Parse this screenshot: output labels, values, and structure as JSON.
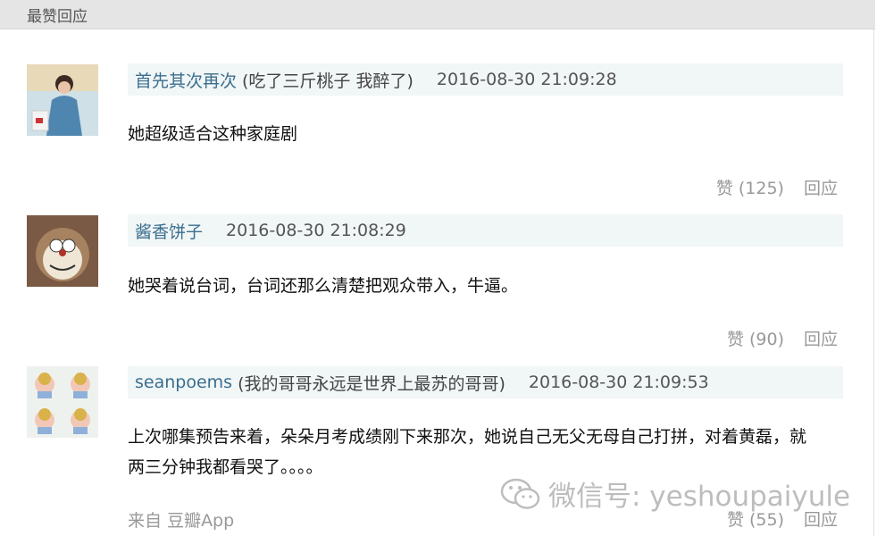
{
  "section": {
    "title": "最赞回应"
  },
  "comments": [
    {
      "author": "首先其次再次",
      "signature": "(吃了三斤桃子 我醉了)",
      "time": "2016-08-30 21:09:28",
      "lines": [
        "她超级适合这种家庭剧"
      ],
      "like_label": "赞 (125)",
      "reply_label": "回应"
    },
    {
      "author": "酱香饼子",
      "signature": "",
      "time": "2016-08-30 21:08:29",
      "lines": [
        "她哭着说台词，台词还那么清楚把观众带入，牛逼。"
      ],
      "like_label": "赞 (90)",
      "reply_label": "回应"
    },
    {
      "author": "seanpoems",
      "signature": "(我的哥哥永远是世界上最苏的哥哥)",
      "time": "2016-08-30 21:09:53",
      "lines": [
        "上次哪集预告来着，朵朵月考成绩刚下来那次，她说自己无父无母自己打拼，对着黄磊，就",
        "两三分钟我都看哭了。。。。"
      ],
      "like_label": "赞 (55)",
      "reply_label": "回应",
      "source_prefix": "来自",
      "source_app": "豆瓣App"
    }
  ],
  "watermark": {
    "text": "微信号: yeshoupaiyule",
    "icon": "wechat-icon"
  }
}
